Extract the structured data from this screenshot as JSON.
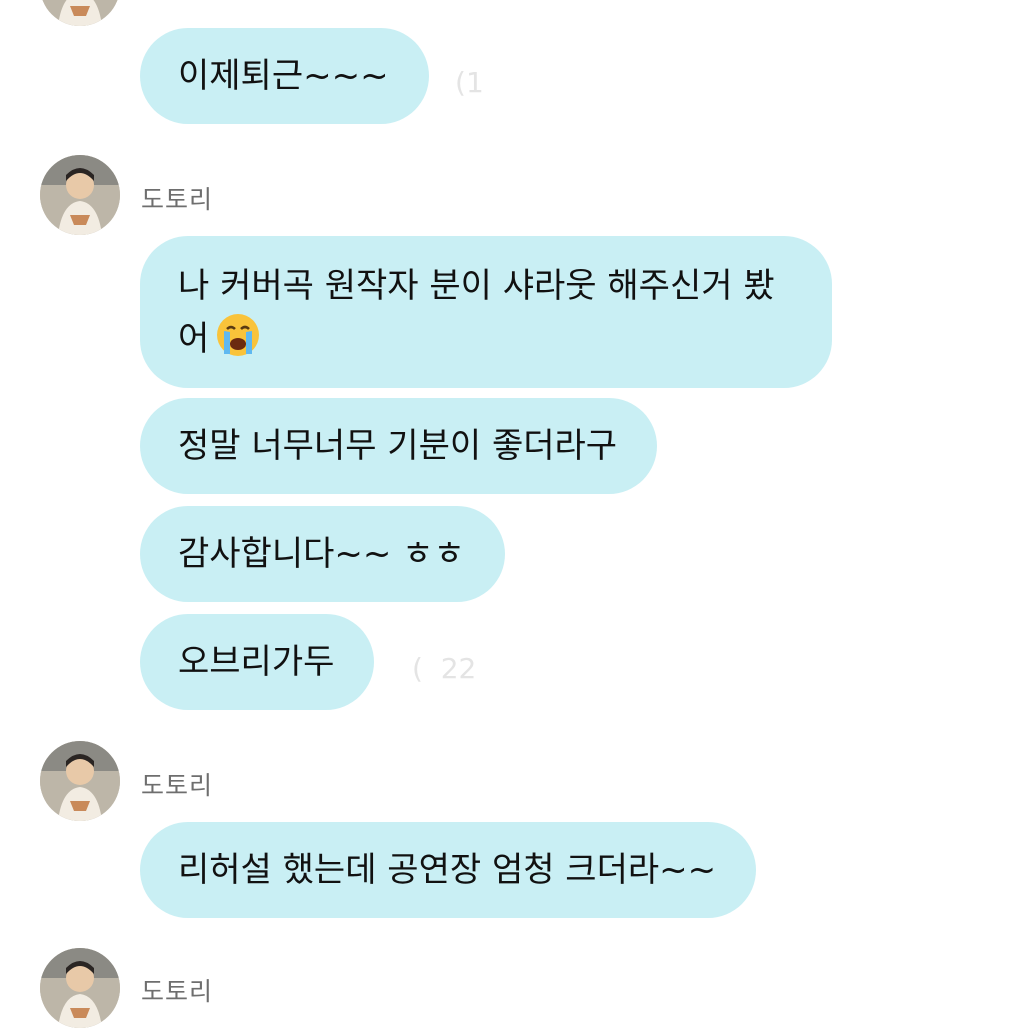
{
  "chat": {
    "sender_name": "도토리",
    "messages": [
      {
        "text": "이제퇴근~~~",
        "time": "1"
      },
      {
        "text": "나 커버곡 원작자 분이 샤라웃 해주신거 봤어"
      },
      {
        "text": "정말 너무너무 기분이 좋더라구"
      },
      {
        "text": "감사합니다~~ ㅎㅎ"
      },
      {
        "text": "오브리가두",
        "time": "22"
      },
      {
        "text": "리허설 했는데 공연장 엄청 크더라~~"
      }
    ],
    "emoji": "loudly-crying-face",
    "colors": {
      "bubble": "#c9eff4",
      "name": "#6e6e6e",
      "background": "#ffffff"
    }
  }
}
